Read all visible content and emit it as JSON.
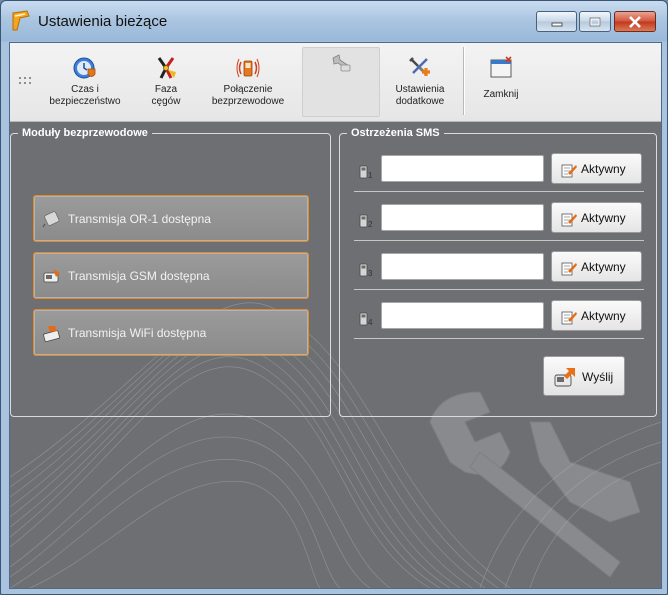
{
  "window": {
    "title": "Ustawienia bieżące",
    "controls": [
      "minimize",
      "maximize",
      "close"
    ]
  },
  "toolbar": {
    "buttons": [
      {
        "label": "Czas i\nbezpieczeństwo",
        "icon": "clock-shield-icon"
      },
      {
        "label": "Faza\ncęgów",
        "icon": "pliers-icon"
      },
      {
        "label": "Połączenie\nbezprzewodowe",
        "icon": "wireless-signal-icon"
      },
      {
        "label": "",
        "icon": "wrench-tool-icon",
        "pressed": true
      },
      {
        "label": "Ustawienia\ndodatkowe",
        "icon": "tools-plus-icon"
      },
      {
        "label": "Zamknij",
        "icon": "window-close-icon"
      }
    ]
  },
  "modules": {
    "label": "Moduły bezprzewodowe",
    "items": [
      {
        "label": "Transmisja OR-1 dostępna",
        "icon": "or1-transmitter-icon"
      },
      {
        "label": "Transmisja GSM dostępna",
        "icon": "gsm-phone-icon"
      },
      {
        "label": "Transmisja WiFi dostępna",
        "icon": "wifi-module-icon"
      }
    ]
  },
  "sms": {
    "label": "Ostrzeżenia SMS",
    "rows": [
      {
        "phone_label": "1",
        "value": "",
        "button": "Aktywny"
      },
      {
        "phone_label": "2",
        "value": "",
        "button": "Aktywny"
      },
      {
        "phone_label": "3",
        "value": "",
        "button": "Aktywny"
      },
      {
        "phone_label": "4",
        "value": "",
        "button": "Aktywny"
      }
    ],
    "send_button": "Wyślij"
  },
  "colors": {
    "accent_orange": "#e08a2a",
    "panel_gray": "#6d6f73",
    "titlebar_blue": "#a9c4e0"
  }
}
